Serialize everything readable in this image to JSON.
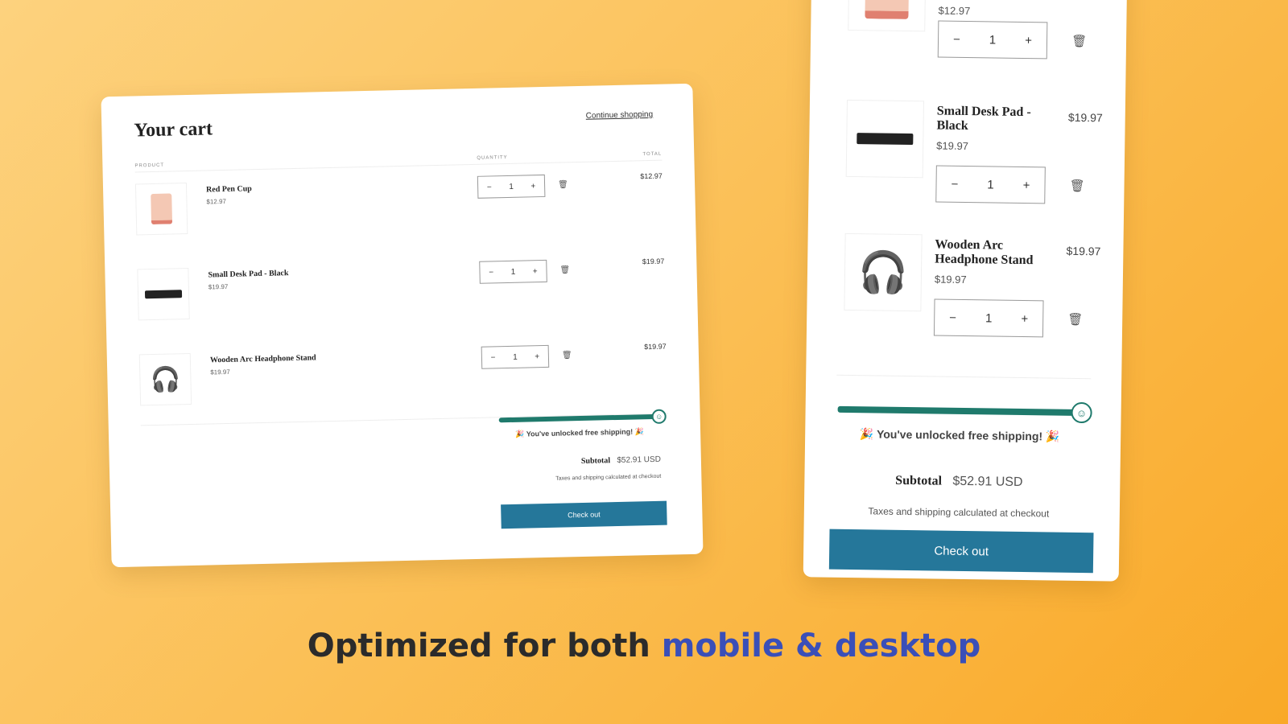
{
  "desktop": {
    "title": "Your cart",
    "continue": "Continue shopping",
    "col_product": "PRODUCT",
    "col_quantity": "QUANTITY",
    "col_total": "TOTAL",
    "items": [
      {
        "name": "Red Pen Cup",
        "price": "$12.97",
        "qty": "1",
        "total": "$12.97"
      },
      {
        "name": "Small Desk Pad - Black",
        "price": "$19.97",
        "qty": "1",
        "total": "$19.97"
      },
      {
        "name": "Wooden Arc Headphone Stand",
        "price": "$19.97",
        "qty": "1",
        "total": "$19.97"
      }
    ],
    "shipping_progress": 100,
    "shipping_msg": "🎉 You've unlocked free shipping! 🎉",
    "subtotal_label": "Subtotal",
    "subtotal": "$52.91 USD",
    "tax_note": "Taxes and shipping calculated at checkout",
    "checkout": "Check out"
  },
  "mobile": {
    "items": [
      {
        "price": "$12.97",
        "qty": "1"
      },
      {
        "name": "Small Desk Pad - Black",
        "price": "$19.97",
        "qty": "1",
        "total": "$19.97"
      },
      {
        "name": "Wooden Arc Headphone Stand",
        "price": "$19.97",
        "qty": "1",
        "total": "$19.97"
      }
    ],
    "shipping_progress": 100,
    "shipping_msg": "🎉 You've unlocked free shipping! 🎉",
    "subtotal_label": "Subtotal",
    "subtotal": "$52.91 USD",
    "tax_note": "Taxes and shipping calculated at checkout",
    "checkout": "Check out"
  },
  "tagline": {
    "part1": "Optimized for both ",
    "part2": "mobile & desktop"
  },
  "colors": {
    "accent": "#25779a",
    "progress": "#1f7a6c",
    "highlight": "#3a4fb8"
  }
}
